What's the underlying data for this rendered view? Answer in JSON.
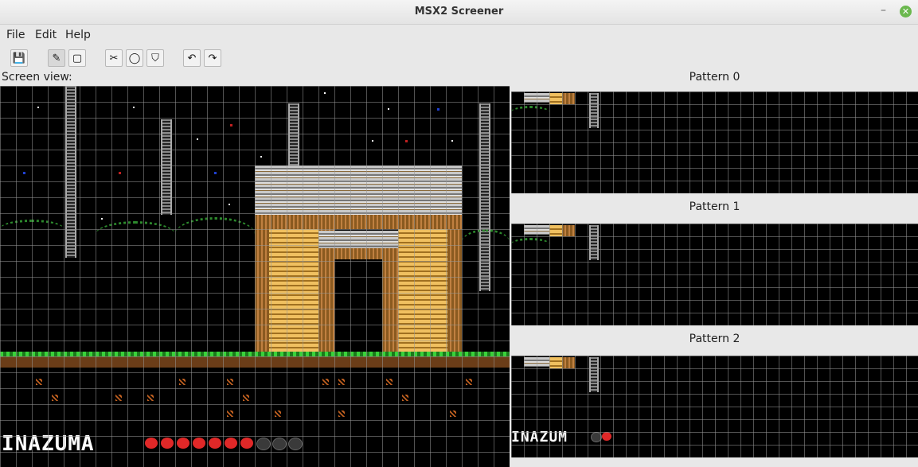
{
  "window": {
    "title": "MSX2 Screener"
  },
  "menu": {
    "file": "File",
    "edit": "Edit",
    "help": "Help"
  },
  "labels": {
    "screen_view": "Screen view:"
  },
  "patterns": [
    {
      "title": "Pattern 0"
    },
    {
      "title": "Pattern 1"
    },
    {
      "title": "Pattern 2"
    }
  ],
  "hud": {
    "name_text": "INAZUMA",
    "pattern_hud_text": "INAZUM"
  },
  "colors": {
    "grass": "#3ad13a",
    "heart_full": "#e02828",
    "heart_empty": "#3a3a3a"
  }
}
